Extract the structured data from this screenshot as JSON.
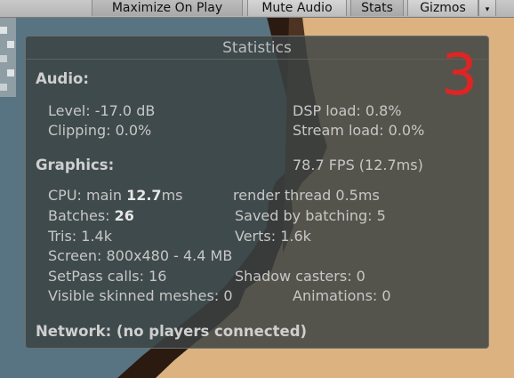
{
  "toolbar": {
    "maximize_on_play": "Maximize On Play",
    "mute_audio": "Mute Audio",
    "stats": "Stats",
    "gizmos": "Gizmos",
    "gizmos_arrow": "▾"
  },
  "stats": {
    "title": "Statistics",
    "badge": "3",
    "audio": {
      "heading": "Audio:",
      "level": "Level: -17.0 dB",
      "clipping": "Clipping: 0.0%",
      "dsp_load": "DSP load: 0.8%",
      "stream_load": "Stream load: 0.0%"
    },
    "graphics": {
      "heading": "Graphics:",
      "fps": "78.7 FPS (12.7ms)",
      "cpu_prefix": "CPU: main ",
      "cpu_main_value": "12.7",
      "cpu_suffix": "ms",
      "render_thread": "render thread 0.5ms",
      "batches_prefix": "Batches: ",
      "batches_value": "26",
      "saved_by_batching": "Saved by batching: 5",
      "tris": "Tris: 1.4k",
      "verts": "Verts: 1.6k",
      "screen": "Screen: 800x480 - 4.4 MB",
      "setpass": "SetPass calls: 16",
      "shadow_casters": "Shadow casters: 0",
      "skinned_meshes": "Visible skinned meshes: 0",
      "animations": "Animations: 0"
    },
    "network": "Network: (no players connected)"
  },
  "colors": {
    "badge": "#e02424",
    "sand": "#dcb281",
    "water": "#587483",
    "shadow": "#2b1a10"
  }
}
